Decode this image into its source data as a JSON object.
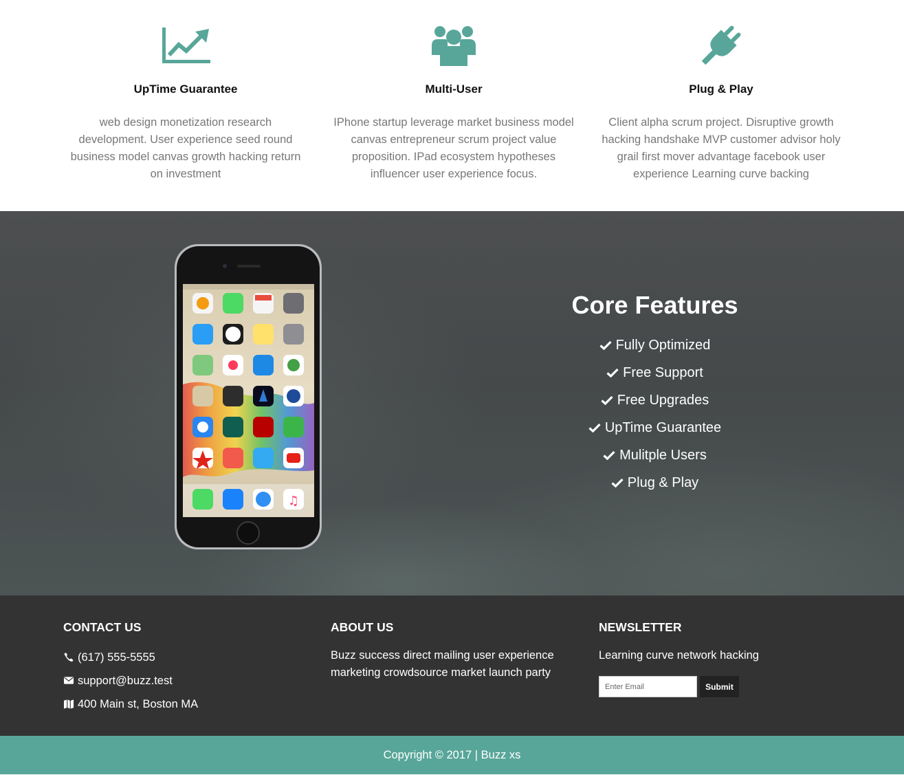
{
  "colors": {
    "accent": "#58a699",
    "footer_bg": "#333333",
    "text_muted": "#777777"
  },
  "features": [
    {
      "icon": "chart-line-icon",
      "title": "UpTime Guarantee",
      "description": "web design monetization research development. User experience seed round business model canvas growth hacking return on investment"
    },
    {
      "icon": "users-icon",
      "title": "Multi-User",
      "description": "IPhone startup leverage market business model canvas entrepreneur scrum project value proposition. IPad ecosystem hypotheses influencer user experience focus."
    },
    {
      "icon": "plug-icon",
      "title": "Plug & Play",
      "description": "Client alpha scrum project. Disruptive growth hacking handshake MVP customer advisor holy grail first mover advantage facebook user experience Learning curve backing"
    }
  ],
  "core_features": {
    "title": "Core Features",
    "items": [
      "Fully Optimized",
      "Free Support",
      "Free Upgrades",
      "UpTime Guarantee",
      "Mulitple Users",
      "Plug & Play"
    ]
  },
  "footer": {
    "contact": {
      "heading": "CONTACT US",
      "phone": "(617) 555-5555",
      "email": "support@buzz.test",
      "address": "400 Main st, Boston MA"
    },
    "about": {
      "heading": "ABOUT US",
      "text": "Buzz success direct mailing user experience marketing crowdsource market launch party"
    },
    "newsletter": {
      "heading": "NEWSLETTER",
      "text": "Learning curve network hacking",
      "input_placeholder": "Enter Email",
      "submit_label": "Submit"
    }
  },
  "copyright": "Copyright © 2017 | Buzz xs"
}
